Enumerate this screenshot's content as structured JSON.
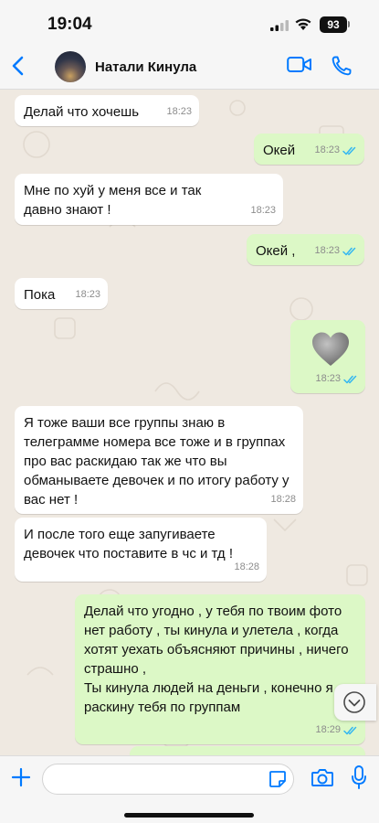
{
  "status_bar": {
    "time": "19:04",
    "battery": "93"
  },
  "header": {
    "contact_name": "Натали Кинула",
    "back_icon": "chevron-left-icon",
    "video_icon": "video-camera-icon",
    "call_icon": "phone-icon"
  },
  "colors": {
    "accent": "#007aff",
    "incoming_bubble": "#ffffff",
    "outgoing_bubble": "#dcf8c6",
    "read_ticks": "#34b7f1",
    "background": "#efe9e1"
  },
  "messages": [
    {
      "direction": "in",
      "text": "Делай что хочешь",
      "time": "18:23"
    },
    {
      "direction": "out",
      "text": "Окей",
      "time": "18:23",
      "status": "read"
    },
    {
      "direction": "in",
      "text": "Мне по хуй у меня все и так давно знают !",
      "time": "18:23"
    },
    {
      "direction": "out",
      "text": "Окей ,",
      "time": "18:23",
      "status": "read"
    },
    {
      "direction": "in",
      "text": "Пока",
      "time": "18:23"
    },
    {
      "direction": "out",
      "text": "",
      "emoji": "grey-heart-icon",
      "time": "18:23",
      "status": "read"
    },
    {
      "direction": "in",
      "text": "Я тоже ваши все группы знаю в телеграмме номера все тоже и в группах про вас раскидаю так же что вы обманываете девочек и по итогу работу у вас нет !",
      "time": "18:28"
    },
    {
      "direction": "in",
      "text": "И после того еще запугиваете девочек что поставите в чс и тд !",
      "time": "18:28"
    },
    {
      "direction": "out",
      "text": "Делай что угодно , у тебя по твоим фото нет работу , ты кинула и улетела , когда хотят уехать объясняют причины , ничего страшно ,\nТы кинула людей на деньги , конечно я раскину тебя по группам",
      "time": "18:29",
      "status": "read"
    }
  ],
  "input": {
    "placeholder": "",
    "value": ""
  },
  "icons": {
    "plus": "plus-icon",
    "sticker": "sticker-icon",
    "camera": "camera-icon",
    "mic": "microphone-icon",
    "scroll": "chevron-down-icon"
  }
}
